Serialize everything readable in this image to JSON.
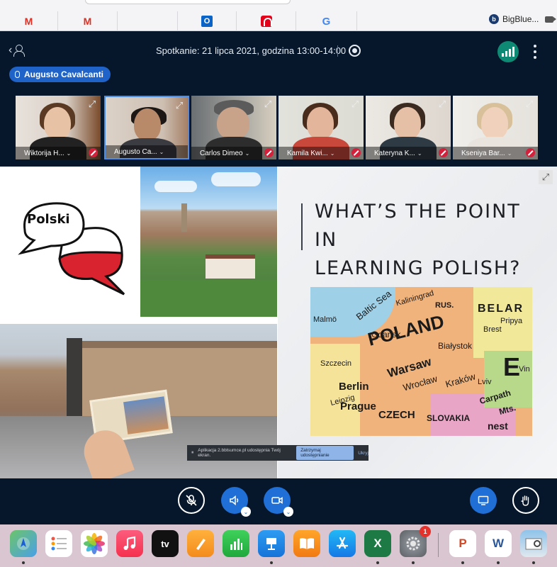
{
  "browser": {
    "bookmarks": [
      {
        "name": "gmail-1",
        "glyph": "M"
      },
      {
        "name": "gmail-2",
        "glyph": "M"
      },
      {
        "name": "outlook",
        "glyph": "O"
      },
      {
        "name": "santander",
        "glyph": ""
      },
      {
        "name": "google",
        "glyph": "G"
      }
    ],
    "tab_title": "BigBlue...",
    "tab_logo": "b"
  },
  "meeting": {
    "title": "Spotkanie: 21 lipca 2021, godzina 13:00-14:00",
    "back_glyph": "‹",
    "current_talker": "Augusto Cavalcanti"
  },
  "participants": [
    {
      "name": "Wiktorija H...",
      "muted": true
    },
    {
      "name": "Augusto Ca...",
      "muted": false,
      "active": true
    },
    {
      "name": "Carlos Dimeo",
      "muted": true
    },
    {
      "name": "Kamila Kwi...",
      "muted": true
    },
    {
      "name": "Kateryna K...",
      "muted": true
    },
    {
      "name": "Kseniya Bar...",
      "muted": true
    }
  ],
  "slide": {
    "bubble_word": "Polski",
    "title_line1": "WHAT’S THE POINT IN",
    "title_line2": "LEARNING POLISH?",
    "map_labels": [
      "POLAND",
      "Gdansk",
      "Białystok",
      "Berlin",
      "Warsaw",
      "Wrocław",
      "Kraków",
      "Prague",
      "Baltic Sea",
      "Kaliningrad",
      "RUS.",
      "BELAR",
      "Pripya",
      "Brest",
      "Szczecin",
      "Leipzig",
      "SLOVAKIA",
      "CZECH",
      "Lviv",
      "Carpath",
      "Mts.",
      "Malmö",
      "E",
      "Vin",
      "nest"
    ],
    "notify_text": "Aplikacja 2.bblsumce.pl udostępnia Twój ekran.",
    "notify_stop": "Zatrzymaj udostępnianie",
    "notify_hide": "Ukryj",
    "expand_glyph": "⤢"
  },
  "controls": {
    "mic": "muted",
    "audio": "on",
    "camera": "on"
  },
  "dock": {
    "apps": [
      "Maps",
      "Reminders",
      "Photos",
      "Music",
      "Apple TV",
      "Pages",
      "Numbers",
      "Keynote",
      "Books",
      "App Store",
      "Excel",
      "System Preferences",
      "PowerPoint",
      "Word",
      "Preview"
    ],
    "tv_label": "tv",
    "excel_glyph": "X",
    "ppt_glyph": "P",
    "word_glyph": "W",
    "settings_badge": "1"
  },
  "colors": {
    "app_bg": "#06172b",
    "accent_blue": "#1f6fd6",
    "muted_red": "#d4213b",
    "connection_green": "#0e8a74"
  }
}
